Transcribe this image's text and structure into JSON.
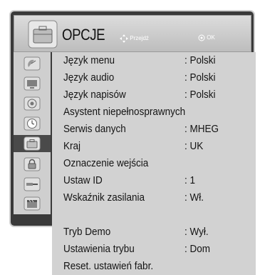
{
  "header": {
    "title": "OPCJE",
    "hint_move": "Przejdź",
    "hint_ok": "OK"
  },
  "sidebar": {
    "items": [
      {
        "icon": "satellite-dish-icon"
      },
      {
        "icon": "monitor-icon"
      },
      {
        "icon": "speaker-icon"
      },
      {
        "icon": "clock-icon"
      },
      {
        "icon": "briefcase-icon",
        "active": true
      },
      {
        "icon": "lock-icon"
      },
      {
        "icon": "input-cable-icon"
      },
      {
        "icon": "clapperboard-icon"
      }
    ]
  },
  "menu": {
    "rows": [
      {
        "label": "Język menu",
        "value": ": Polski"
      },
      {
        "label": "Język audio",
        "value": ": Polski"
      },
      {
        "label": "Język napisów",
        "value": ": Polski"
      },
      {
        "label": "Asystent niepełnosprawnych",
        "value": ""
      },
      {
        "label": "Serwis danych",
        "value": ": MHEG"
      },
      {
        "label": "Kraj",
        "value": ": UK"
      },
      {
        "label": "Oznaczenie wejścia",
        "value": ""
      },
      {
        "label": "Ustaw ID",
        "value": ": 1"
      },
      {
        "label": "Wskaźnik zasilania",
        "value": ": Wł."
      },
      {
        "label": "Tryb Demo",
        "value": ": Wył."
      },
      {
        "label": "Ustawienia trybu",
        "value": ": Dom"
      },
      {
        "label": "Reset. ustawień fabr.",
        "value": ""
      }
    ],
    "selected_index": 8
  },
  "colors": {
    "header": "#c8c8c8",
    "menu_bg": "#d2d2d2",
    "selected_row": "#8e8e8e",
    "frame": "#3a3a3a"
  }
}
